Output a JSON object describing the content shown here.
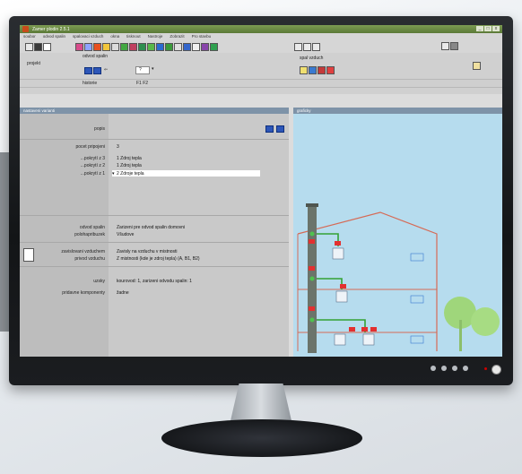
{
  "app": {
    "title": "Zamer plodin 2.5.1",
    "window_buttons": [
      "_",
      "□",
      "x"
    ]
  },
  "menu": [
    "soubor",
    "odvod spalin",
    "spalovaci vzduch",
    "okna",
    "tisknout",
    "Nastroje",
    "Zobrazit",
    "Pro stavbu"
  ],
  "toolbar": {
    "projekt": "projekt",
    "odvod_spalin": "odvod spalin",
    "historie": "historie",
    "history_keys": "F1  F2",
    "help": "?",
    "privod_vzduchu": "spal vzduch"
  },
  "panels": {
    "left_title": "nastaveni varianti",
    "right_title": "graficky"
  },
  "form": {
    "popis_label": "popis",
    "pocet_pripojeni_label": "pocet pripojeni",
    "pocet_pripojeni_value": "3",
    "rows": [
      {
        "label": "...pokrytí z 3",
        "value": "1 Zdroj tepla"
      },
      {
        "label": "...pokrytí z 2",
        "value": "1 Zdroj tepla"
      },
      {
        "label": "...pokrytí z 1",
        "value": "2 Zdroje tepla"
      }
    ],
    "odvod_spalin_label": "odvod spalin",
    "odvod_spalin_value": "Zarizeni pre odvod spalin domovni",
    "polohapribuzek_label": "polohapribuzek",
    "polohapribuzek_value": "Všudove",
    "zavislovani_label": "zavislovani vzduchem",
    "zavislovani_value": "Zavisly na vzduchu v mistnosti",
    "privod_vzduchu_label": "privod vzduchu",
    "privod_vzduchu_value": "Z mistnosti (kde je zdroj tepla) (A, B1, B2)",
    "uzsky_label": "uzsky",
    "uzsky_value": "kourovod: 1, zarizeni odvodu spalin: 1",
    "pridavne_label": "pridavne komponenty",
    "pridavne_value": "žadne"
  },
  "colors": {
    "title_bar": "#6a8a45",
    "panel_header": "#7e93a8",
    "sky": "#b6dcee",
    "house_line": "#d66a55",
    "chimney": "#6b746b",
    "flue": "#33a233",
    "tree": "#9fd67b",
    "nav_btn": "#2d56b8"
  }
}
